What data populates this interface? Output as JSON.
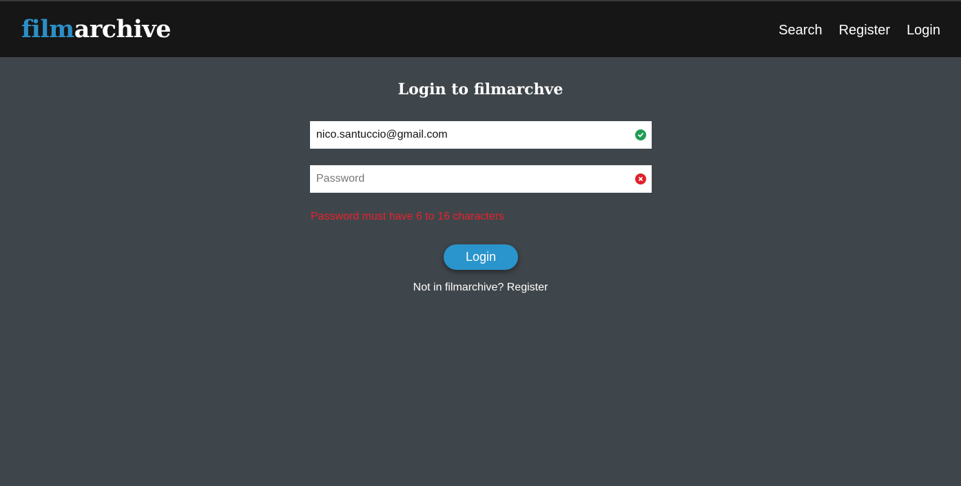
{
  "header": {
    "logo_part1": "film",
    "logo_part2": "archive",
    "nav": [
      {
        "label": "Search"
      },
      {
        "label": "Register"
      },
      {
        "label": "Login"
      }
    ]
  },
  "form": {
    "title": "Login to filmarchve",
    "email": {
      "value": "nico.santuccio@gmail.com",
      "status": "valid",
      "status_icon": "check-circle-icon"
    },
    "password": {
      "value": "",
      "placeholder": "Password",
      "status": "invalid",
      "status_icon": "x-circle-icon"
    },
    "error_message": "Password must have 6 to 16 characters",
    "submit_label": "Login",
    "register_prompt": "Not in filmarchive?",
    "register_link": "Register"
  },
  "colors": {
    "brand": "#2c8fc6",
    "topbar": "#161616",
    "background": "#3f464b",
    "button": "#2a94cc",
    "valid": "#1f9d55",
    "error": "#e8222e"
  }
}
